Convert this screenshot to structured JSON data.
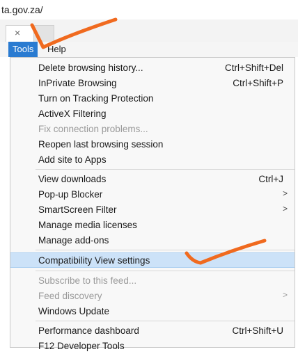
{
  "address": {
    "text": "ta.gov.za/"
  },
  "tabs": {
    "close_glyph": "×"
  },
  "menubar": {
    "tools": "Tools",
    "help": "Help"
  },
  "menu": {
    "items": [
      {
        "label": "Delete browsing history...",
        "shortcut": "Ctrl+Shift+Del"
      },
      {
        "label": "InPrivate Browsing",
        "shortcut": "Ctrl+Shift+P"
      },
      {
        "label": "Turn on Tracking Protection"
      },
      {
        "label": "ActiveX Filtering"
      },
      {
        "label": "Fix connection problems..."
      },
      {
        "label": "Reopen last browsing session"
      },
      {
        "label": "Add site to Apps"
      },
      {
        "label": "View downloads",
        "shortcut": "Ctrl+J"
      },
      {
        "label": "Pop-up Blocker",
        "submenu": ">"
      },
      {
        "label": "SmartScreen Filter",
        "submenu": ">"
      },
      {
        "label": "Manage media licenses"
      },
      {
        "label": "Manage add-ons"
      },
      {
        "label": "Compatibility View settings"
      },
      {
        "label": "Subscribe to this feed..."
      },
      {
        "label": "Feed discovery",
        "submenu": ">"
      },
      {
        "label": "Windows Update"
      },
      {
        "label": "Performance dashboard",
        "shortcut": "Ctrl+Shift+U"
      },
      {
        "label": "F12 Developer Tools"
      }
    ]
  },
  "colors": {
    "menu_active": "#2a7bd1",
    "highlight": "#cce2f8",
    "annotation": "#f06a1f"
  }
}
